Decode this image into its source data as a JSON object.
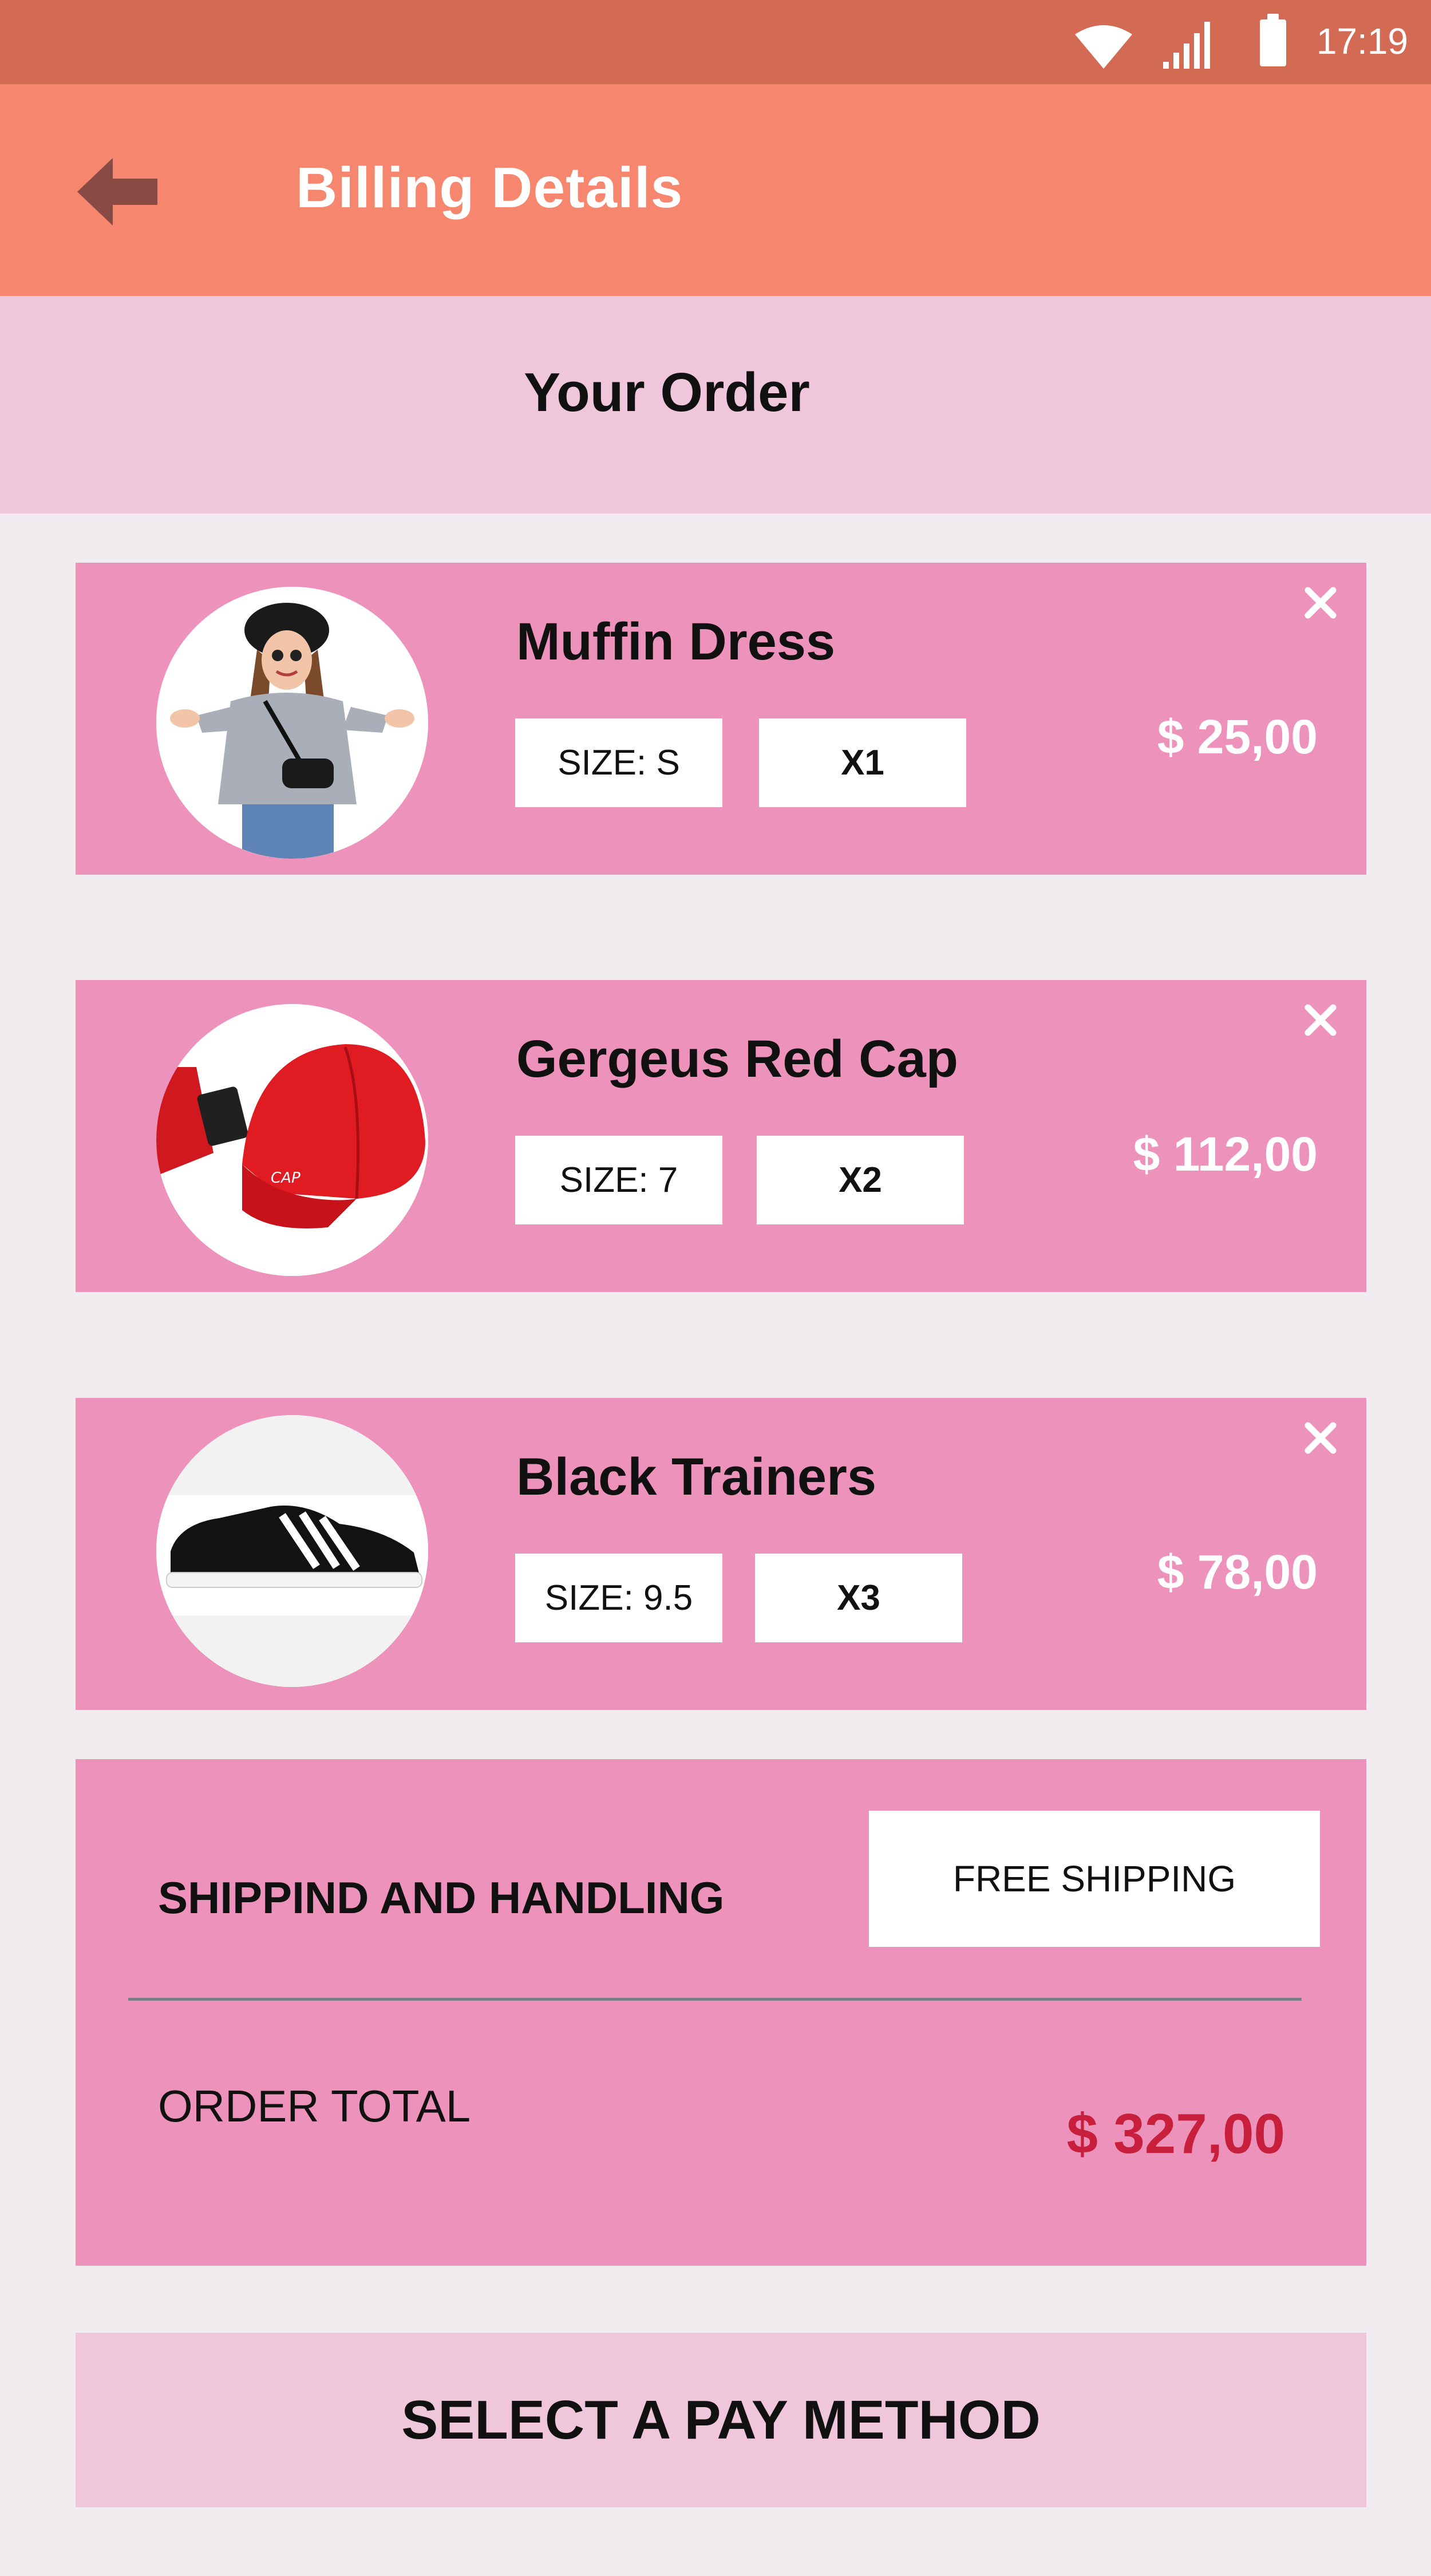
{
  "status_bar": {
    "time": "17:19",
    "icons": [
      "wifi-icon",
      "signal-icon",
      "battery-icon"
    ]
  },
  "header": {
    "title": "Billing  Details",
    "back_icon": "back-arrow-icon"
  },
  "section": {
    "title": "Your  Order"
  },
  "items": [
    {
      "name": "Muffin Dress",
      "size": "SIZE:  S",
      "qty": "X1",
      "price": "$ 25,00",
      "image": "woman-in-hat-photo"
    },
    {
      "name": "Gergeus Red Cap",
      "size": "SIZE:  7",
      "qty": "X2",
      "price": "$ 112,00",
      "image": "red-cap-photo"
    },
    {
      "name": "Black Trainers",
      "size": "SIZE:  9.5",
      "qty": "X3",
      "price": "$ 78,00",
      "image": "black-trainers-photo"
    }
  ],
  "summary": {
    "shipping_label": "SHIPPIND AND HANDLING",
    "shipping_value": "FREE SHIPPING",
    "total_label": "ORDER TOTAL",
    "total_value": "$ 327,00"
  },
  "pay_button": "SELECT A PAY METHOD",
  "colors": {
    "status_bar": "#d36b54",
    "header": "#f6866e",
    "section_bar": "#f0c6da",
    "card": "#ed92bb",
    "background": "#f0ecf0",
    "total_price": "#c81f3c"
  }
}
